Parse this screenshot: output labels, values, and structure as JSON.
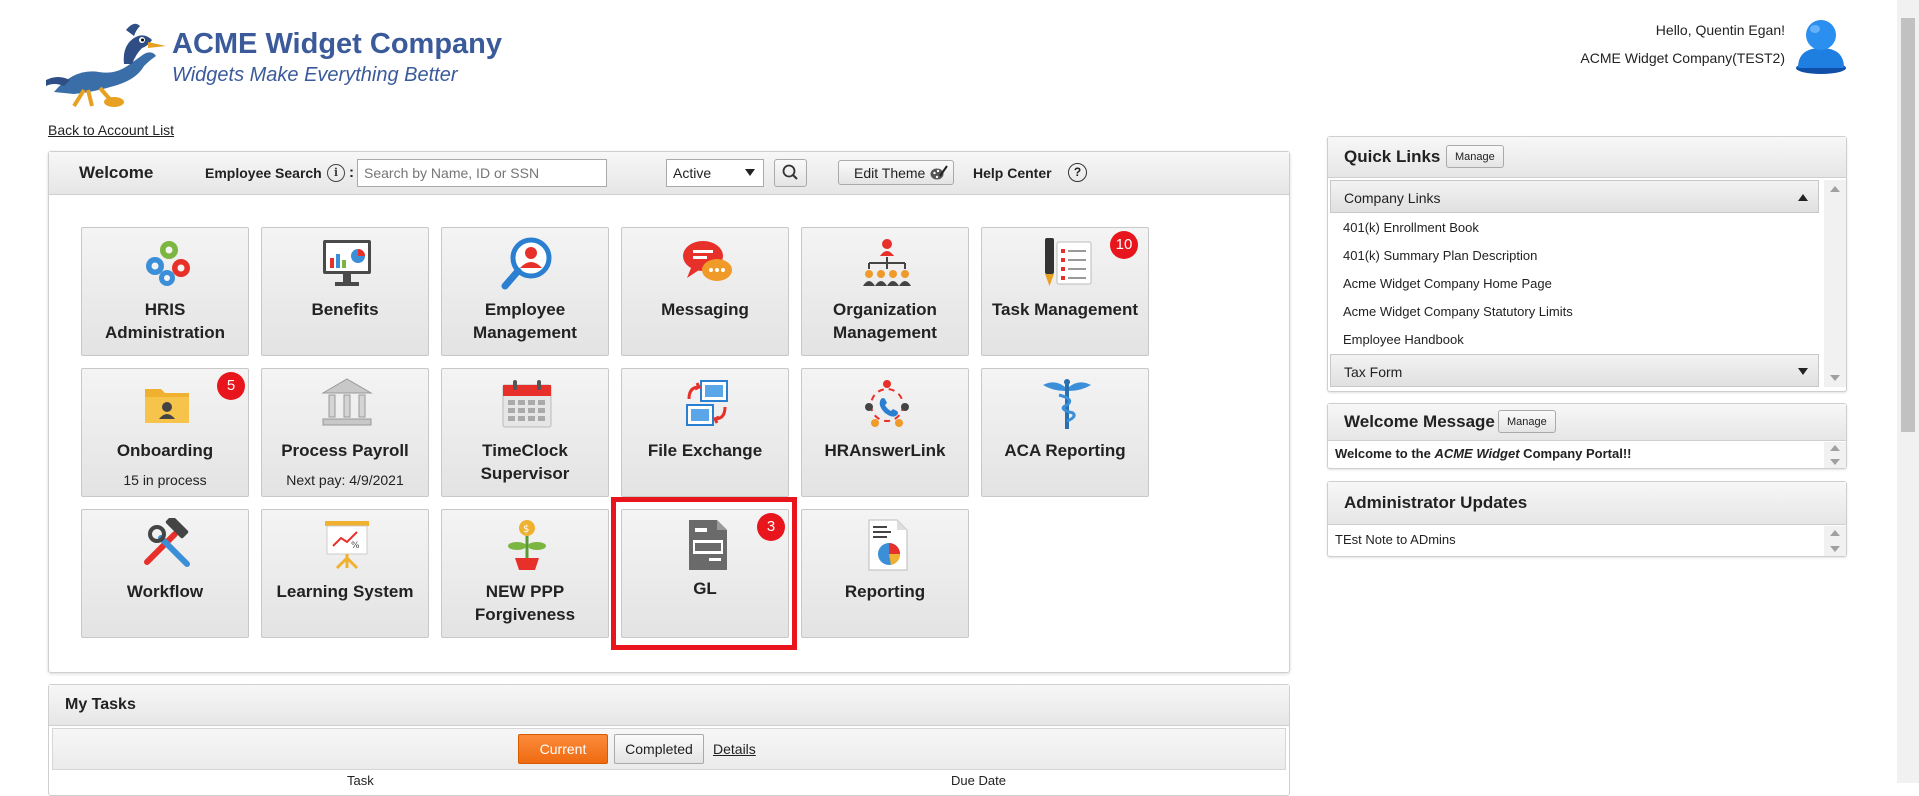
{
  "header": {
    "company_name": "ACME Widget Company",
    "tagline": "Widgets Make Everything Better",
    "back_link": "Back to Account List",
    "greeting": "Hello, Quentin Egan!",
    "account": "ACME Widget Company(TEST2)"
  },
  "toolbar": {
    "welcome": "Welcome",
    "employee_search_label": "Employee Search",
    "info_glyph": "i",
    "colon": ":",
    "search_placeholder": "Search by Name, ID or SSN",
    "status_value": "Active",
    "edit_theme": "Edit Theme",
    "help_center": "Help Center",
    "help_glyph": "?"
  },
  "tiles": [
    {
      "label": "HRIS Administration",
      "icon": "gears-people-icon"
    },
    {
      "label": "Benefits",
      "icon": "monitor-chart-icon"
    },
    {
      "label": "Employee Management",
      "icon": "magnify-person-icon"
    },
    {
      "label": "Messaging",
      "icon": "chat-bubbles-icon"
    },
    {
      "label": "Organization Management",
      "icon": "org-chart-icon"
    },
    {
      "label": "Task Management",
      "icon": "pen-checklist-icon",
      "badge": "10"
    },
    {
      "label": "Onboarding",
      "sub": "15 in process",
      "icon": "folder-person-icon",
      "badge": "5"
    },
    {
      "label": "Process Payroll",
      "sub": "Next pay: 4/9/2021",
      "icon": "bank-icon"
    },
    {
      "label": "TimeClock Supervisor",
      "icon": "calendar-icon"
    },
    {
      "label": "File Exchange",
      "icon": "file-exchange-icon"
    },
    {
      "label": "HRAnswerLink",
      "icon": "phone-network-icon"
    },
    {
      "label": "ACA Reporting",
      "icon": "caduceus-icon"
    },
    {
      "label": "Workflow",
      "icon": "hammer-wrench-icon"
    },
    {
      "label": "Learning System",
      "icon": "presentation-board-icon"
    },
    {
      "label": "NEW PPP Forgiveness",
      "icon": "money-plant-icon"
    },
    {
      "label": "GL",
      "icon": "document-icon",
      "badge": "3"
    },
    {
      "label": "Reporting",
      "icon": "report-pie-icon"
    }
  ],
  "tasks": {
    "title": "My Tasks",
    "current": "Current",
    "completed": "Completed",
    "details": "Details",
    "col_task": "Task",
    "col_due": "Due Date"
  },
  "quick_links": {
    "title": "Quick Links",
    "manage": "Manage",
    "group_open": "Company Links",
    "links": [
      "401(k) Enrollment Book",
      "401(k) Summary Plan Description",
      "Acme Widget Company Home Page",
      "Acme Widget Company Statutory Limits",
      "Employee Handbook"
    ],
    "group_closed": "Tax Form"
  },
  "welcome_message": {
    "title": "Welcome Message",
    "manage": "Manage",
    "text_before": "Welcome to the ",
    "text_em": "ACME Widget",
    "text_after": " Company Portal!!"
  },
  "admin_updates": {
    "title": "Administrator Updates",
    "text": "TEst Note to ADmins"
  },
  "colors": {
    "brand_blue": "#3a5a9a",
    "badge_red": "#e8151c",
    "current_orange": "#ef6a10"
  }
}
